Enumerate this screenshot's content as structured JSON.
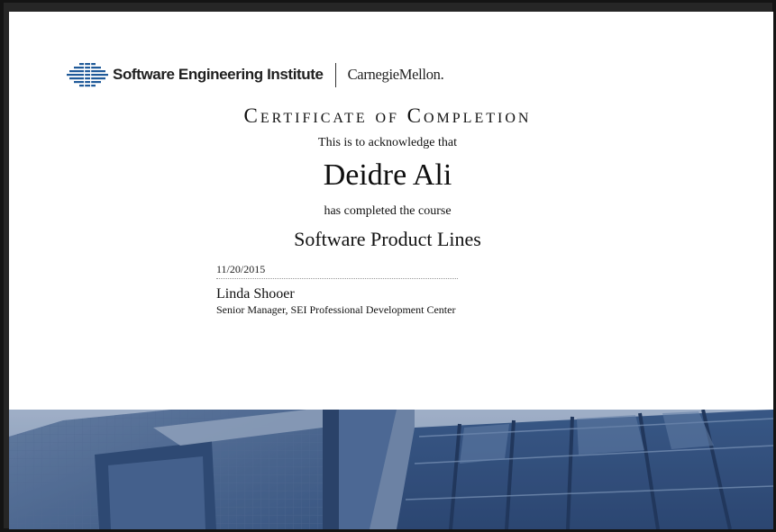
{
  "header": {
    "sei_name": "Software Engineering Institute",
    "university": "CarnegieMellon."
  },
  "certificate": {
    "title": "Certificate of Completion",
    "acknowledge": "This is to acknowledge that",
    "recipient": "Deidre Ali",
    "completed": "has completed the course",
    "course": "Software Product Lines",
    "date": "11/20/2015",
    "signer_name": "Linda Shooer",
    "signer_title": "Senior Manager, SEI Professional Development Center"
  },
  "colors": {
    "sei_blue": "#1f5a99",
    "photo_tint": "#3f5f8c"
  }
}
